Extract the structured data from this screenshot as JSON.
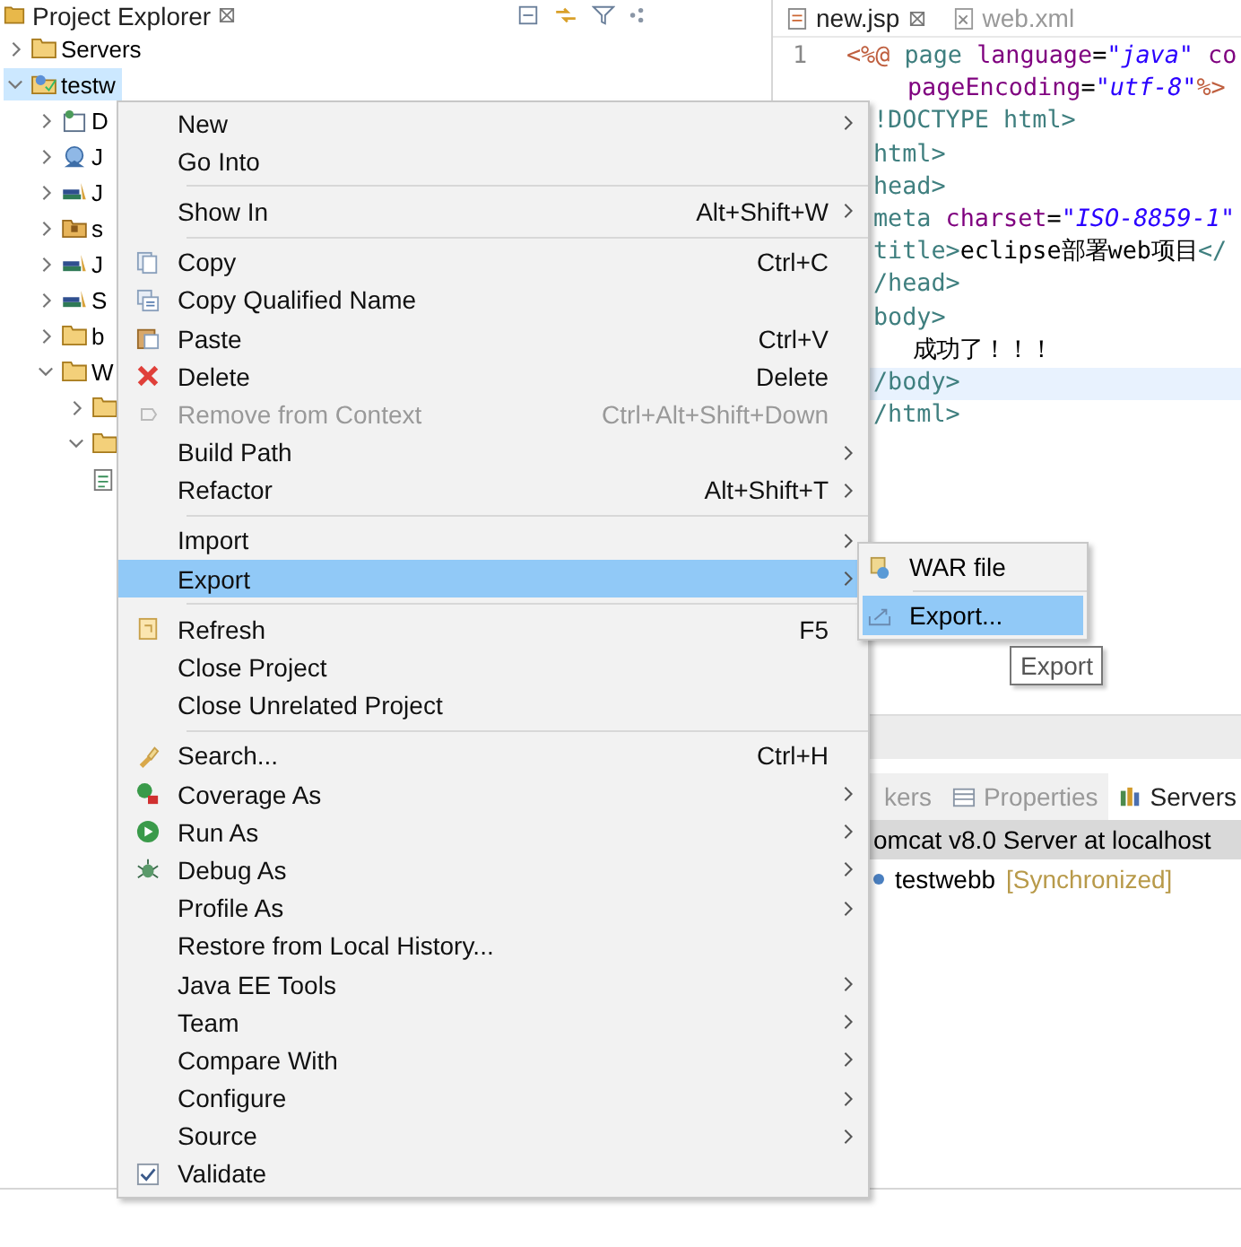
{
  "project_explorer": {
    "title": "Project Explorer",
    "tree": [
      {
        "label": "Servers",
        "kind": "folder",
        "expanded": false,
        "selected": false
      },
      {
        "label": "testw",
        "kind": "project",
        "expanded": true,
        "selected": true,
        "children": [
          {
            "label": "D",
            "kind": "descriptor",
            "expanded": false,
            "selected": false
          },
          {
            "label": "J",
            "kind": "web-services",
            "expanded": false,
            "selected": false
          },
          {
            "label": "J",
            "kind": "library",
            "expanded": false,
            "selected": false
          },
          {
            "label": "s",
            "kind": "package",
            "expanded": false,
            "selected": false
          },
          {
            "label": "J",
            "kind": "library",
            "expanded": false,
            "selected": false
          },
          {
            "label": "S",
            "kind": "library",
            "expanded": false,
            "selected": false
          },
          {
            "label": "b",
            "kind": "folder",
            "expanded": false,
            "selected": false
          },
          {
            "label": "W",
            "kind": "folder",
            "expanded": true,
            "selected": false,
            "children": [
              {
                "kind": "folder",
                "expanded": false,
                "selected": false
              },
              {
                "kind": "folder",
                "expanded": true,
                "selected": false
              },
              {
                "kind": "file",
                "selected": false
              }
            ]
          }
        ]
      }
    ]
  },
  "editor": {
    "tabs": [
      {
        "label": "new.jsp",
        "kind": "jsp",
        "selected": true
      },
      {
        "label": "web.xml",
        "kind": "xml",
        "selected": false
      }
    ],
    "lines": [
      {
        "number": "1",
        "current": false,
        "segments": [
          {
            "text": "<%@",
            "kind": "jsp"
          },
          {
            "text": " page ",
            "kind": "tag"
          },
          {
            "text": "language",
            "kind": "attr"
          },
          {
            "text": "=",
            "kind": "text"
          },
          {
            "text": "\"java\"",
            "kind": "string"
          },
          {
            "text": " co",
            "kind": "attr"
          }
        ]
      },
      {
        "current": false,
        "segments": [
          {
            "text": "pageEncoding",
            "kind": "attr"
          },
          {
            "text": "=",
            "kind": "text"
          },
          {
            "text": "\"utf-8\"",
            "kind": "string"
          },
          {
            "text": "%>",
            "kind": "jsp"
          }
        ]
      },
      {
        "current": false,
        "segments": [
          {
            "text": "!DOCTYPE html>",
            "kind": "tag"
          }
        ]
      },
      {
        "current": false,
        "segments": [
          {
            "text": "html>",
            "kind": "tag"
          }
        ]
      },
      {
        "current": false,
        "segments": [
          {
            "text": "head>",
            "kind": "tag"
          }
        ]
      },
      {
        "current": false,
        "segments": [
          {
            "text": "meta",
            "kind": "tag"
          },
          {
            "text": " charset",
            "kind": "attr"
          },
          {
            "text": "=",
            "kind": "text"
          },
          {
            "text": "\"ISO-8859-1\"",
            "kind": "string"
          }
        ]
      },
      {
        "current": false,
        "segments": [
          {
            "text": "title>",
            "kind": "tag"
          },
          {
            "text": "eclipse部署web项目",
            "kind": "text"
          },
          {
            "text": "</",
            "kind": "tag"
          }
        ]
      },
      {
        "current": false,
        "segments": [
          {
            "text": "/head>",
            "kind": "tag"
          }
        ]
      },
      {
        "current": false,
        "segments": [
          {
            "text": "body>",
            "kind": "tag"
          }
        ]
      },
      {
        "current": false,
        "segments": [
          {
            "text": "成功了！！！",
            "kind": "text"
          }
        ]
      },
      {
        "current": true,
        "segments": [
          {
            "text": "/body>",
            "kind": "tag"
          }
        ]
      },
      {
        "current": false,
        "segments": [
          {
            "text": "/html>",
            "kind": "tag"
          }
        ]
      }
    ]
  },
  "bottom_panel": {
    "tabs": [
      {
        "label": "kers",
        "kind": "plain",
        "selected": false
      },
      {
        "label": "Properties",
        "kind": "properties",
        "selected": false
      },
      {
        "label": "Servers",
        "kind": "servers",
        "selected": true
      }
    ],
    "rows": [
      {
        "label": "omcat v8.0 Server at localhost",
        "selected": true
      },
      {
        "label": "testwebb",
        "status": "[Synchronized]",
        "selected": false
      }
    ]
  },
  "context_menu": {
    "groups": [
      [
        {
          "label": "New",
          "kind": "plain",
          "submenu": true,
          "selected": false,
          "disabled": false
        },
        {
          "label": "Go Into",
          "kind": "plain",
          "submenu": false,
          "selected": false,
          "disabled": false
        }
      ],
      [
        {
          "label": "Show In",
          "shortcut": "Alt+Shift+W",
          "kind": "plain",
          "submenu": true,
          "selected": false,
          "disabled": false
        }
      ],
      [
        {
          "label": "Copy",
          "shortcut": "Ctrl+C",
          "kind": "copy",
          "submenu": false,
          "selected": false,
          "disabled": false
        },
        {
          "label": "Copy Qualified Name",
          "kind": "copy-name",
          "submenu": false,
          "selected": false,
          "disabled": false
        },
        {
          "label": "Paste",
          "shortcut": "Ctrl+V",
          "kind": "paste",
          "submenu": false,
          "selected": false,
          "disabled": false
        },
        {
          "label": "Delete",
          "shortcut": "Delete",
          "kind": "delete",
          "submenu": false,
          "selected": false,
          "disabled": false
        },
        {
          "label": "Remove from Context",
          "shortcut": "Ctrl+Alt+Shift+Down",
          "kind": "remove",
          "submenu": false,
          "selected": false,
          "disabled": true
        },
        {
          "label": "Build Path",
          "kind": "plain",
          "submenu": true,
          "selected": false,
          "disabled": false
        },
        {
          "label": "Refactor",
          "shortcut": "Alt+Shift+T",
          "kind": "plain",
          "submenu": true,
          "selected": false,
          "disabled": false
        }
      ],
      [
        {
          "label": "Import",
          "kind": "plain",
          "submenu": true,
          "selected": false,
          "disabled": false
        },
        {
          "label": "Export",
          "kind": "plain",
          "submenu": true,
          "selected": true,
          "disabled": false
        }
      ],
      [
        {
          "label": "Refresh",
          "shortcut": "F5",
          "kind": "refresh",
          "submenu": false,
          "selected": false,
          "disabled": false
        },
        {
          "label": "Close Project",
          "kind": "plain",
          "submenu": false,
          "selected": false,
          "disabled": false
        },
        {
          "label": "Close Unrelated Project",
          "kind": "plain",
          "submenu": false,
          "selected": false,
          "disabled": false
        }
      ],
      [
        {
          "label": "Search...",
          "shortcut": "Ctrl+H",
          "kind": "search",
          "submenu": false,
          "selected": false,
          "disabled": false
        },
        {
          "label": "Coverage As",
          "kind": "coverage",
          "submenu": true,
          "selected": false,
          "disabled": false
        },
        {
          "label": "Run As",
          "kind": "run",
          "submenu": true,
          "selected": false,
          "disabled": false
        },
        {
          "label": "Debug As",
          "kind": "debug",
          "submenu": true,
          "selected": false,
          "disabled": false
        },
        {
          "label": "Profile As",
          "kind": "plain",
          "submenu": true,
          "selected": false,
          "disabled": false
        },
        {
          "label": "Restore from Local History...",
          "kind": "plain",
          "submenu": false,
          "selected": false,
          "disabled": false
        },
        {
          "label": "Java EE Tools",
          "kind": "plain",
          "submenu": true,
          "selected": false,
          "disabled": false
        },
        {
          "label": "Team",
          "kind": "plain",
          "submenu": true,
          "selected": false,
          "disabled": false
        },
        {
          "label": "Compare With",
          "kind": "plain",
          "submenu": true,
          "selected": false,
          "disabled": false
        },
        {
          "label": "Configure",
          "kind": "plain",
          "submenu": true,
          "selected": false,
          "disabled": false
        },
        {
          "label": "Source",
          "kind": "plain",
          "submenu": true,
          "selected": false,
          "disabled": false
        },
        {
          "label": "Validate",
          "kind": "check",
          "checked": true,
          "submenu": false,
          "selected": false,
          "disabled": false
        }
      ]
    ]
  },
  "submenu": {
    "groups": [
      [
        {
          "label": "WAR file",
          "kind": "war",
          "selected": false
        }
      ],
      [
        {
          "label": "Export...",
          "kind": "export",
          "selected": true
        }
      ]
    ]
  },
  "tooltip": {
    "text": "Export"
  }
}
